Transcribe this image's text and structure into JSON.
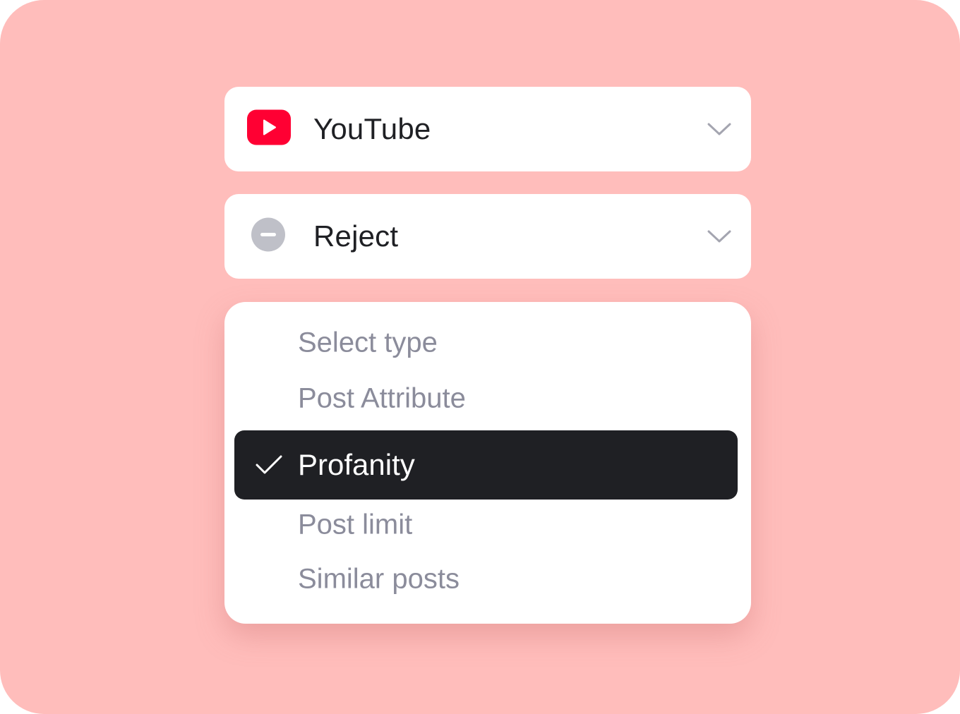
{
  "colors": {
    "background": "#ffbdbb",
    "card": "#ffffff",
    "text_primary": "#1f2024",
    "text_muted": "#8b8c9b",
    "selected_bg": "#1f2024",
    "youtube_red": "#ff0033",
    "reject_gray": "#bfc0c8",
    "chevron": "#a4a5b0"
  },
  "platform_select": {
    "icon": "youtube-icon",
    "label": "YouTube",
    "chevron": "chevron-down-icon"
  },
  "action_select": {
    "icon": "minus-circle-icon",
    "label": "Reject",
    "chevron": "chevron-down-icon"
  },
  "type_dropdown": {
    "options": [
      {
        "label": "Select type",
        "selected": false
      },
      {
        "label": "Post Attribute",
        "selected": false
      },
      {
        "label": "Profanity",
        "selected": true,
        "icon": "check-icon"
      },
      {
        "label": "Post limit",
        "selected": false
      },
      {
        "label": "Similar posts",
        "selected": false
      }
    ]
  }
}
